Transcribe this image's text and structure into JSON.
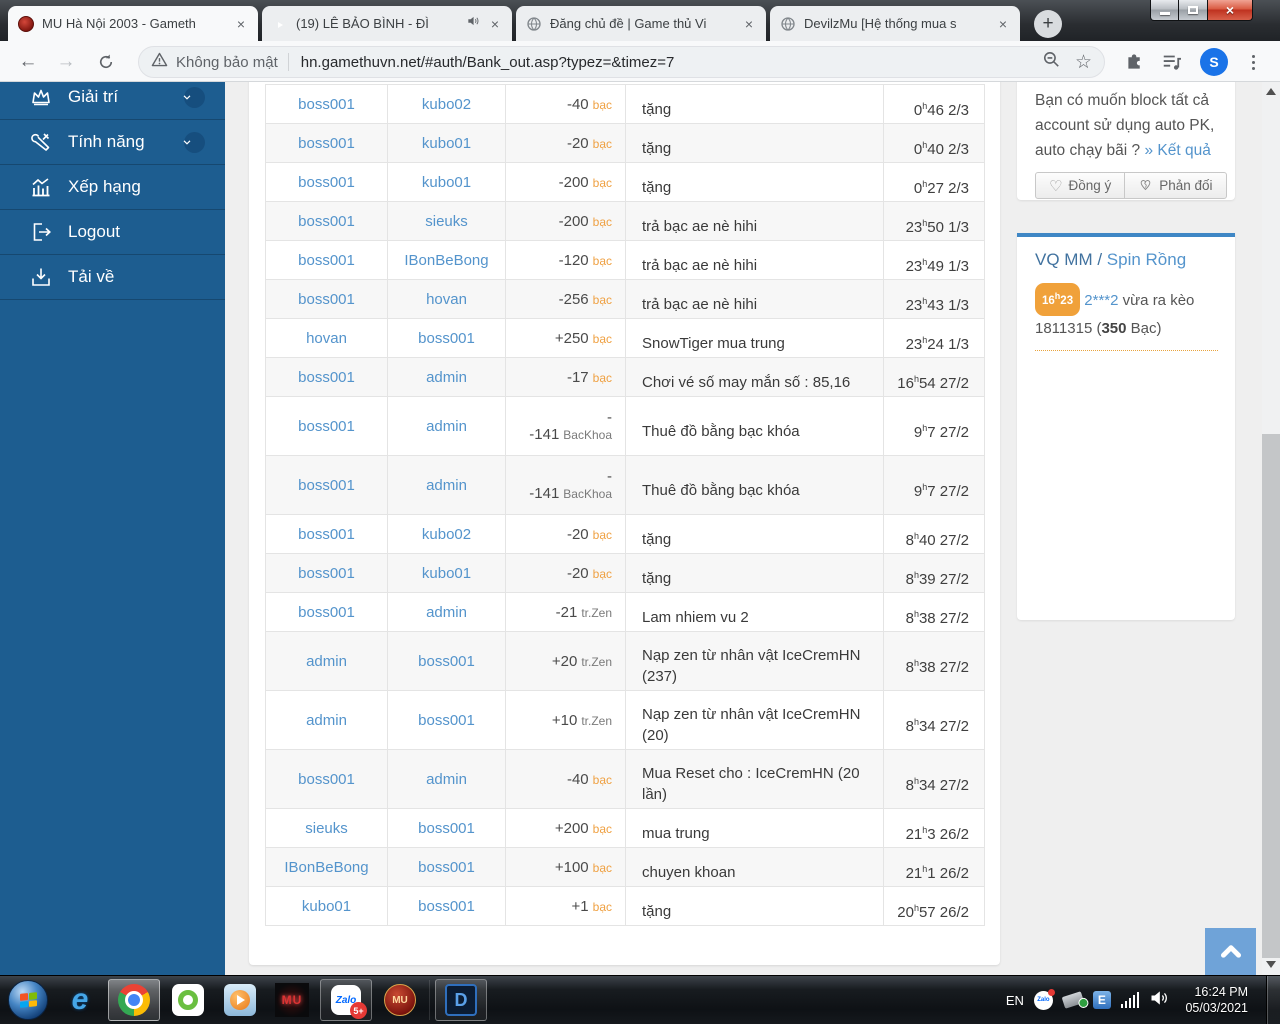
{
  "ui": {
    "hour_mark": "h",
    "new_tab_glyph": "+",
    "tab_close_glyph": "×",
    "close_glyph": "×",
    "back_glyph": "←",
    "forward_glyph": "→",
    "star_glyph": "☆",
    "heart_glyph": "♡",
    "colors": {
      "accent_blue": "#1d5d90",
      "link_blue": "#5494cc",
      "orange": "#efa143",
      "panel_accent": "#3f87c5"
    }
  },
  "browser": {
    "tabs": [
      {
        "title": "MU Hà Nội 2003 - Gameth",
        "icon": "mu-favicon"
      },
      {
        "title": "(19) LÊ BẢO BÌNH - ĐÌ",
        "icon": "youtube-favicon",
        "audio": true
      },
      {
        "title": "Đăng chủ đề | Game thủ Vi",
        "icon": "globe-favicon"
      },
      {
        "title": "DevilzMu [Hệ thống mua s",
        "icon": "globe-favicon"
      }
    ],
    "security_label": "Không bảo mật",
    "url": "hn.gamethuvn.net/#auth/Bank_out.asp?typez=&timez=7",
    "avatar_letter": "S"
  },
  "sidebar": {
    "items": [
      {
        "label": "Giải trí",
        "icon": "crown-icon",
        "chevron": true
      },
      {
        "label": "Tính năng",
        "icon": "tools-icon",
        "chevron": true
      },
      {
        "label": "Xếp hạng",
        "icon": "chart-icon"
      },
      {
        "label": "Logout",
        "icon": "logout-icon"
      },
      {
        "label": "Tải về",
        "icon": "download-icon"
      }
    ]
  },
  "table": {
    "rows": [
      {
        "from": "boss001",
        "to": "kubo02",
        "num": "-40",
        "unit": "bạc",
        "note": "tặng",
        "time": {
          "h": "0",
          "m": "46",
          "date": "2/3"
        }
      },
      {
        "from": "boss001",
        "to": "kubo01",
        "num": "-20",
        "unit": "bạc",
        "note": "tặng",
        "time": {
          "h": "0",
          "m": "40",
          "date": "2/3"
        }
      },
      {
        "from": "boss001",
        "to": "kubo01",
        "num": "-200",
        "unit": "bạc",
        "note": "tặng",
        "time": {
          "h": "0",
          "m": "27",
          "date": "2/3"
        }
      },
      {
        "from": "boss001",
        "to": "sieuks",
        "num": "-200",
        "unit": "bạc",
        "note": "trả bạc ae nè hihi",
        "time": {
          "h": "23",
          "m": "50",
          "date": "1/3"
        }
      },
      {
        "from": "boss001",
        "to": "IBonBeBong",
        "num": "-120",
        "unit": "bạc",
        "note": "trả bạc ae nè hihi",
        "time": {
          "h": "23",
          "m": "49",
          "date": "1/3"
        }
      },
      {
        "from": "boss001",
        "to": "hovan",
        "num": "-256",
        "unit": "bạc",
        "note": "trả bạc ae nè hihi",
        "time": {
          "h": "23",
          "m": "43",
          "date": "1/3"
        }
      },
      {
        "from": "hovan",
        "to": "boss001",
        "num": "+250",
        "unit": "bạc",
        "note": "SnowTiger mua trung",
        "time": {
          "h": "23",
          "m": "24",
          "date": "1/3"
        }
      },
      {
        "from": "boss001",
        "to": "admin",
        "num": "-17",
        "unit": "bạc",
        "note": "Chơi vé số may mắn số : 85,16",
        "time": {
          "h": "16",
          "m": "54",
          "date": "27/2"
        }
      },
      {
        "from": "boss001",
        "to": "admin",
        "prefix": "-",
        "num": "-141",
        "unit": "BacKhoa",
        "note": "Thuê đồ bằng bạc khóa",
        "time": {
          "h": "9",
          "m": "7",
          "date": "27/2"
        },
        "tall": true
      },
      {
        "from": "boss001",
        "to": "admin",
        "prefix": "-",
        "num": "-141",
        "unit": "BacKhoa",
        "note": "Thuê đồ bằng bạc khóa",
        "time": {
          "h": "9",
          "m": "7",
          "date": "27/2"
        },
        "tall": true
      },
      {
        "from": "boss001",
        "to": "kubo02",
        "num": "-20",
        "unit": "bạc",
        "note": "tặng",
        "time": {
          "h": "8",
          "m": "40",
          "date": "27/2"
        }
      },
      {
        "from": "boss001",
        "to": "kubo01",
        "num": "-20",
        "unit": "bạc",
        "note": "tặng",
        "time": {
          "h": "8",
          "m": "39",
          "date": "27/2"
        }
      },
      {
        "from": "boss001",
        "to": "admin",
        "num": "-21",
        "unit": "tr.Zen",
        "note": "Lam nhiem vu 2",
        "time": {
          "h": "8",
          "m": "38",
          "date": "27/2"
        }
      },
      {
        "from": "admin",
        "to": "boss001",
        "num": "+20",
        "unit": "tr.Zen",
        "note": "Nạp zen từ nhân vật IceCremHN (237)",
        "time": {
          "h": "8",
          "m": "38",
          "date": "27/2"
        },
        "tall": true
      },
      {
        "from": "admin",
        "to": "boss001",
        "num": "+10",
        "unit": "tr.Zen",
        "note": "Nạp zen từ nhân vật IceCremHN (20)",
        "time": {
          "h": "8",
          "m": "34",
          "date": "27/2"
        },
        "tall": true
      },
      {
        "from": "boss001",
        "to": "admin",
        "num": "-40",
        "unit": "bạc",
        "note": "Mua Reset cho : IceCremHN (20 lần)",
        "time": {
          "h": "8",
          "m": "34",
          "date": "27/2"
        },
        "tall": true
      },
      {
        "from": "sieuks",
        "to": "boss001",
        "num": "+200",
        "unit": "bạc",
        "note": "mua trung",
        "time": {
          "h": "21",
          "m": "3",
          "date": "26/2"
        }
      },
      {
        "from": "IBonBeBong",
        "to": "boss001",
        "num": "+100",
        "unit": "bạc",
        "note": "chuyen khoan",
        "time": {
          "h": "21",
          "m": "1",
          "date": "26/2"
        }
      },
      {
        "from": "kubo01",
        "to": "boss001",
        "num": "+1",
        "unit": "bạc",
        "note": "tặng",
        "time": {
          "h": "20",
          "m": "57",
          "date": "26/2"
        }
      }
    ]
  },
  "poll": {
    "question": "Bạn có muốn block tất cả account sử dụng auto PK, auto chạy bãi ? ",
    "result_link": "» Kết quả",
    "agree_label": "Đồng ý",
    "disagree_label": "Phản đối"
  },
  "spin": {
    "title_a": "VQ MM",
    "title_sep": " / ",
    "title_b": "Spin Rồng",
    "badge": {
      "h": "16",
      "m": "23"
    },
    "user": "2***2",
    "line1_text": " vừa ra kèo",
    "line2_pre": "1811315 (",
    "line2_bold": "350",
    "line2_post": " Bạc)"
  },
  "taskbar": {
    "lang": "EN",
    "clock_time": "16:24 PM",
    "clock_date": "05/03/2021",
    "icons": {
      "ie_glyph": "e",
      "mu_dark_label": "MU",
      "zalo_label": "Zalo",
      "zalo_badge": "5+",
      "mu_red_label": "MU",
      "d_label": "D",
      "tray_zalo_label": "Zalo",
      "tray_e_label": "E"
    }
  }
}
